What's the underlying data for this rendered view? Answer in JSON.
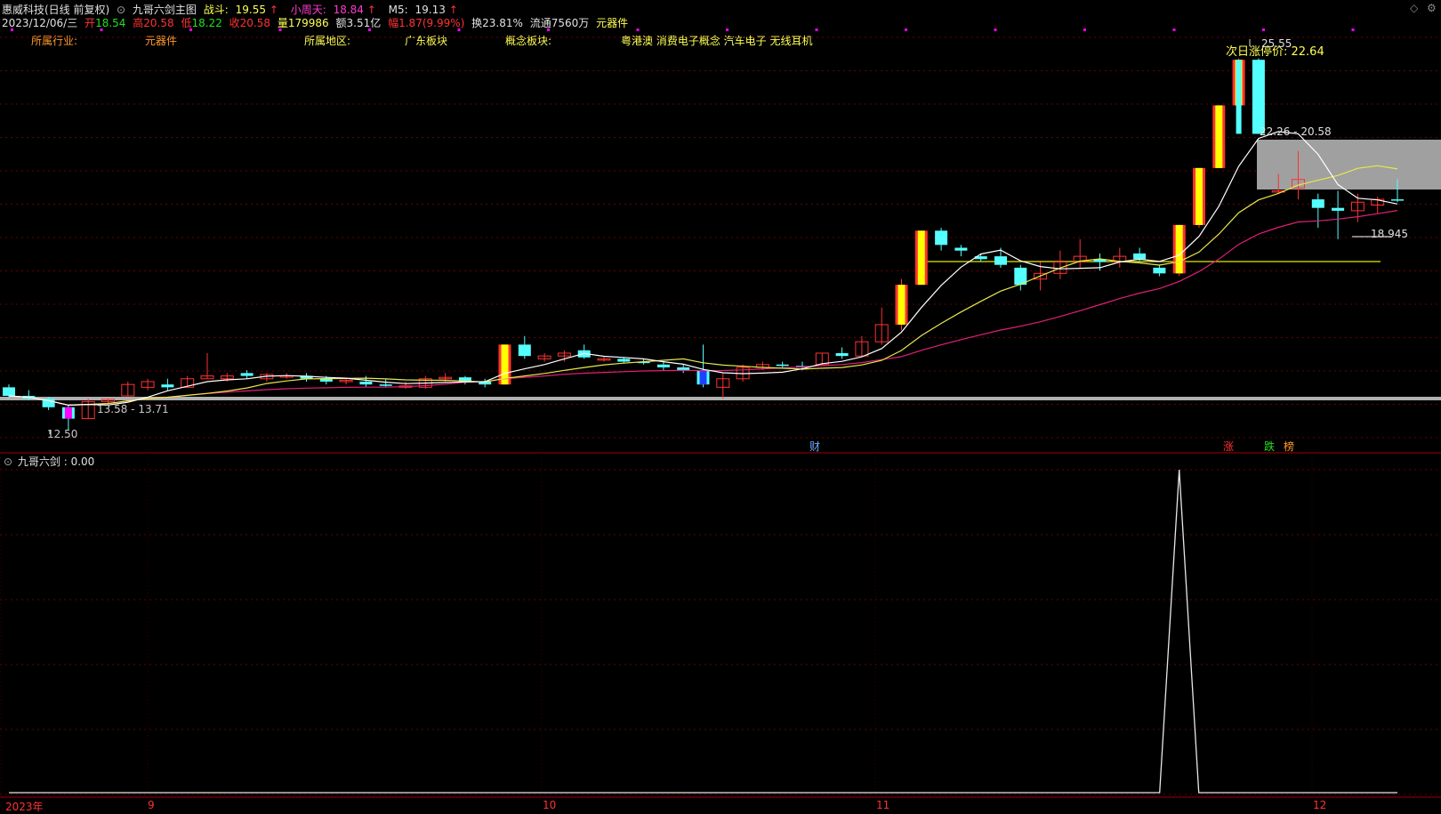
{
  "colors": {
    "bg": "#000000",
    "up": "#ff3232",
    "down": "#54ffff",
    "limit_up": "#ffff00",
    "yellow_text": "#ffff54",
    "magenta": "#ff00ff",
    "grid": "#6b0000",
    "ma_white": "#ffffff",
    "ma_yellow": "#e8e84a",
    "ma_pink": "#e0207a",
    "gray_zone": "#a0a0a0"
  },
  "header": {
    "stock_title": "惠威科技(日线 前复权)",
    "indicator_name": "九哥六剑主图",
    "zhandou_label": "战斗:",
    "zhandou_value": "19.55",
    "xiaozhoutian_label": "小周天:",
    "xiaozhoutian_value": "18.84",
    "m5_label": "M5:",
    "m5_value": "19.13",
    "arrow_up": "↑"
  },
  "quote": {
    "date": "2023/12/06/三",
    "open_label": "开",
    "open": "18.54",
    "high_label": "高",
    "high": "20.58",
    "low_label": "低",
    "low": "18.22",
    "close_label": "收",
    "close": "20.58",
    "vol_label": "量",
    "vol": "179986",
    "amt_label": "额",
    "amt": "3.51亿",
    "chg_label": "幅",
    "chg": "1.87(9.99%)",
    "turn_label": "换",
    "turn": "23.81%",
    "float_label": "流通",
    "float": "7560万",
    "sector": "元器件"
  },
  "info": {
    "industry_label": "所属行业:",
    "industry_value": "元器件",
    "region_label": "所属地区:",
    "region_value": "广东板块",
    "concept_label": "概念板块:",
    "concept_value": "粤港澳 消费电子概念 汽车电子 无线耳机"
  },
  "annotations": {
    "next_limit": "次日涨停价: 22.64",
    "peak_price": "25.55",
    "box_range": "22.26 - 20.58",
    "last_price": "18.945",
    "low_range": "13.58 - 13.71",
    "low_price": "12.50"
  },
  "markers": {
    "cai": "财",
    "zhang": "涨",
    "die": "跌",
    "bang": "榜"
  },
  "sub_indicator": {
    "label": "九哥六剑",
    "value": ": 0.00"
  },
  "x_axis": [
    "2023年",
    "9",
    "10",
    "11",
    "12"
  ],
  "window": {
    "diamond_icon": "◇",
    "gear_icon": "⚙"
  },
  "chart_data": {
    "type": "candlestick",
    "title": "惠威科技(日线 前复权)",
    "candles_ohlc": [
      [
        14.0,
        14.1,
        13.6,
        13.7
      ],
      [
        13.7,
        13.9,
        13.55,
        13.6
      ],
      [
        13.6,
        13.65,
        13.2,
        13.3
      ],
      [
        13.3,
        13.4,
        12.5,
        12.9
      ],
      [
        12.9,
        13.6,
        12.9,
        13.5
      ],
      [
        13.5,
        13.6,
        13.4,
        13.58
      ],
      [
        13.7,
        14.2,
        13.7,
        14.1
      ],
      [
        14.0,
        14.3,
        13.9,
        14.2
      ],
      [
        14.1,
        14.3,
        13.9,
        14.0
      ],
      [
        14.0,
        14.4,
        14.0,
        14.3
      ],
      [
        14.3,
        15.2,
        14.3,
        14.4
      ],
      [
        14.3,
        14.5,
        14.2,
        14.4
      ],
      [
        14.5,
        14.6,
        14.3,
        14.4
      ],
      [
        14.3,
        14.5,
        14.2,
        14.45
      ],
      [
        14.4,
        14.5,
        14.3,
        14.4
      ],
      [
        14.4,
        14.5,
        14.2,
        14.3
      ],
      [
        14.3,
        14.4,
        14.1,
        14.2
      ],
      [
        14.2,
        14.3,
        14.1,
        14.25
      ],
      [
        14.2,
        14.4,
        14.0,
        14.1
      ],
      [
        14.1,
        14.3,
        14.0,
        14.05
      ],
      [
        14.0,
        14.2,
        13.95,
        14.05
      ],
      [
        14.0,
        14.4,
        13.95,
        14.3
      ],
      [
        14.3,
        14.5,
        14.2,
        14.35
      ],
      [
        14.35,
        14.4,
        14.1,
        14.2
      ],
      [
        14.2,
        14.3,
        14.0,
        14.1
      ],
      [
        14.1,
        15.5,
        14.1,
        15.5
      ],
      [
        15.5,
        15.8,
        15.0,
        15.1
      ],
      [
        15.0,
        15.2,
        14.9,
        15.1
      ],
      [
        15.1,
        15.3,
        14.9,
        15.2
      ],
      [
        15.3,
        15.5,
        15.0,
        15.05
      ],
      [
        15.0,
        15.1,
        14.9,
        15.0
      ],
      [
        15.0,
        15.05,
        14.85,
        14.9
      ],
      [
        14.9,
        15.0,
        14.8,
        14.85
      ],
      [
        14.8,
        14.9,
        14.6,
        14.7
      ],
      [
        14.7,
        14.8,
        14.5,
        14.6
      ],
      [
        14.6,
        15.5,
        14.0,
        14.1
      ],
      [
        14.0,
        14.5,
        13.6,
        14.3
      ],
      [
        14.3,
        14.8,
        14.2,
        14.7
      ],
      [
        14.7,
        14.9,
        14.6,
        14.8
      ],
      [
        14.8,
        14.9,
        14.7,
        14.75
      ],
      [
        14.75,
        14.9,
        14.6,
        14.7
      ],
      [
        14.8,
        15.2,
        14.8,
        15.2
      ],
      [
        15.2,
        15.4,
        15.0,
        15.1
      ],
      [
        15.1,
        15.8,
        15.1,
        15.6
      ],
      [
        15.6,
        16.8,
        15.5,
        16.2
      ],
      [
        16.2,
        17.8,
        16.0,
        17.6
      ],
      [
        17.6,
        19.5,
        17.6,
        19.5
      ],
      [
        19.5,
        19.6,
        18.8,
        19.0
      ],
      [
        18.9,
        19.0,
        18.6,
        18.8
      ],
      [
        18.6,
        18.7,
        18.4,
        18.5
      ],
      [
        18.6,
        18.9,
        18.2,
        18.3
      ],
      [
        18.2,
        18.3,
        17.4,
        17.6
      ],
      [
        17.8,
        18.4,
        17.4,
        18.0
      ],
      [
        18.0,
        18.8,
        17.8,
        18.4
      ],
      [
        18.4,
        19.2,
        18.2,
        18.6
      ],
      [
        18.5,
        18.7,
        18.1,
        18.4
      ],
      [
        18.4,
        18.9,
        18.2,
        18.6
      ],
      [
        18.7,
        18.9,
        18.4,
        18.5
      ],
      [
        18.2,
        18.3,
        17.9,
        18.0
      ],
      [
        18.0,
        19.7,
        17.9,
        19.7
      ],
      [
        19.7,
        21.7,
        19.6,
        21.7
      ],
      [
        21.7,
        23.9,
        21.7,
        23.9
      ],
      [
        23.9,
        25.55,
        23.9,
        25.5
      ],
      [
        25.5,
        25.55,
        22.9,
        22.9
      ],
      [
        20.9,
        21.5,
        20.8,
        20.9
      ],
      [
        21.0,
        22.3,
        20.6,
        21.3
      ],
      [
        20.6,
        20.8,
        19.6,
        20.3
      ],
      [
        20.3,
        20.9,
        19.2,
        20.2
      ],
      [
        20.2,
        20.8,
        19.8,
        20.5
      ],
      [
        20.4,
        20.7,
        20.1,
        20.6
      ],
      [
        20.6,
        21.3,
        20.5,
        20.58
      ]
    ],
    "ma_lines": [
      "白线 MA5",
      "黄线 MA10",
      "粉线 MA20"
    ],
    "sub_series": {
      "name": "九哥六剑",
      "peak_value": 1,
      "peak_index": 59
    }
  }
}
